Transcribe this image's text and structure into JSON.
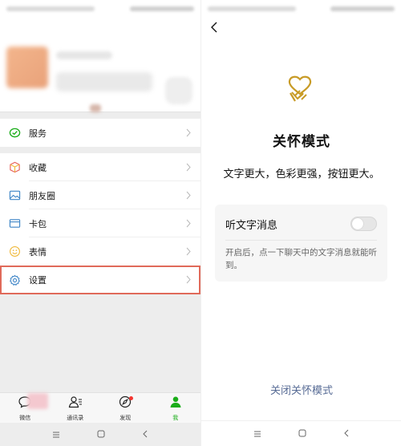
{
  "left": {
    "menu_group_1": [
      {
        "label": "服务",
        "icon": "wechat-pay-icon"
      }
    ],
    "menu_group_2": [
      {
        "label": "收藏",
        "icon": "favorites-cube-icon"
      },
      {
        "label": "朋友圈",
        "icon": "moments-photo-icon"
      },
      {
        "label": "卡包",
        "icon": "card-wallet-icon"
      },
      {
        "label": "表情",
        "icon": "sticker-smile-icon"
      }
    ],
    "menu_group_3": [
      {
        "label": "设置",
        "icon": "settings-gear-icon"
      }
    ],
    "tabs": [
      {
        "label": "微信",
        "icon": "chat-bubble-icon"
      },
      {
        "label": "通讯录",
        "icon": "contacts-icon"
      },
      {
        "label": "发现",
        "icon": "compass-icon"
      },
      {
        "label": "我",
        "icon": "person-icon"
      }
    ],
    "colors": {
      "accent_green": "#1aad19",
      "highlight_red": "#e06a5a"
    }
  },
  "right": {
    "title": "关怀模式",
    "description": "文字更大，色彩更强，按钮更大。",
    "card": {
      "title": "听文字消息",
      "toggle_on": false,
      "description": "开启后，点一下聊天中的文字消息就能听到。"
    },
    "close_link": "关闭关怀模式",
    "colors": {
      "icon_gold": "#c89b26",
      "link_blue": "#576b95"
    }
  }
}
